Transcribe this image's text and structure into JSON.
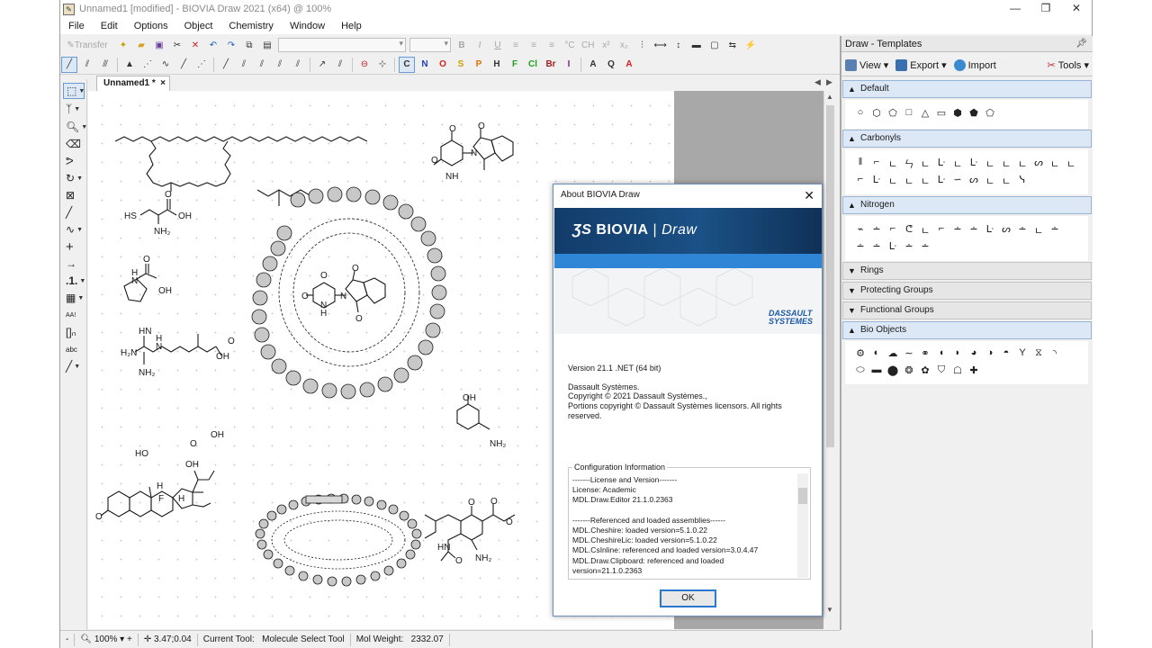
{
  "window": {
    "title": "Unnamed1 [modified] - BIOVIA Draw 2021 (x64)  @ 100%",
    "buttons": [
      "—",
      "❐",
      "✕"
    ]
  },
  "menu": [
    "File",
    "Edit",
    "Options",
    "Object",
    "Chemistry",
    "Window",
    "Help"
  ],
  "toolbar": {
    "transfer_label": "Transfer",
    "atom_buttons": [
      "C",
      "N",
      "O",
      "S",
      "P",
      "H",
      "F",
      "Cl",
      "Br",
      "I"
    ],
    "text_buttons": [
      "A",
      "Q"
    ]
  },
  "document_tab": {
    "label": "Unnamed1 *",
    "close": "×"
  },
  "canvas_labels": {
    "cys_hs": "HS",
    "cys_oh": "OH",
    "cys_nh2": "NH₂",
    "cys_o": "O",
    "pro_h": "H",
    "pro_n": "N",
    "pro_o": "O",
    "pro_oh": "OH",
    "arg_h2n": "H₂N",
    "arg_hn": "HN",
    "arg_nh2": "NH₂",
    "arg_n": "N",
    "arg_h": "H",
    "arg_o": "O",
    "arg_oh": "OH",
    "thal_o1": "O",
    "thal_o2": "O",
    "thal_o3": "O",
    "thal_n": "N",
    "thal_nh": "NH",
    "mic_o1": "O",
    "mic_o2": "O",
    "mic_o3": "O",
    "mic_n": "N",
    "mic_h": "H",
    "mic_n2": "N",
    "mic_o4": "O",
    "phen_oh": "OH",
    "phen_nh2": "NH₂",
    "ster_o": "O",
    "ster_ho": "HO",
    "ster_h1": "H",
    "ster_h2": "H",
    "ster_f": "F",
    "ster_o2": "O",
    "ster_oh": "OH",
    "ster_oh2": "OH",
    "osel_o1": "O",
    "osel_o2": "O",
    "osel_o3": "O",
    "osel_hn": "HN",
    "osel_nh2": "NH₂",
    "osel_o4": "O"
  },
  "status": {
    "zoom": "100%",
    "coords": "3.47;0.04",
    "current_tool_label": "Current Tool:",
    "current_tool": "Molecule Select Tool",
    "mol_weight_label": "Mol Weight:",
    "mol_weight": "2332.07"
  },
  "templates": {
    "title": "Draw - Templates",
    "view": "View",
    "export": "Export",
    "import": "Import",
    "tools": "Tools",
    "groups": [
      {
        "label": "Default",
        "open": true
      },
      {
        "label": "Carbonyls",
        "open": true
      },
      {
        "label": "Nitrogen",
        "open": true
      },
      {
        "label": "Rings",
        "open": false
      },
      {
        "label": "Protecting Groups",
        "open": false
      },
      {
        "label": "Functional Groups",
        "open": false
      },
      {
        "label": "Bio Objects",
        "open": true
      }
    ],
    "default_shapes": [
      "○",
      "⬡",
      "⬠",
      "□",
      "△",
      "▭",
      "⬢",
      "⬟",
      "⬠"
    ],
    "carbonyl_row1": [
      "ǁ",
      "⌐",
      "ㄴ",
      "ㄣ",
      "ㄴ",
      "ᒷ",
      "ㄴ",
      "ᒷ",
      "ㄴ",
      "ㄴ",
      "ㄴ",
      "ᔕ",
      "ㄴ",
      "ㄴ"
    ],
    "carbonyl_row2": [
      "⌐",
      "ᒷ",
      "ㄴ",
      "ㄴ",
      "ㄴ",
      "ᒷ",
      "∽",
      "ᔕ",
      "ㄴ",
      "ㄴ",
      "ᓭ"
    ],
    "nitrogen_row1": [
      "⌁",
      "∸",
      "⌐",
      "ᕦ",
      "ㄴ",
      "⌐",
      "∸",
      "∸",
      "ᒷ",
      "ᔕ",
      "∸",
      "ㄴ",
      "∸"
    ],
    "nitrogen_row2": [
      "∸",
      "∸",
      "ᒷ",
      "∸",
      "∸"
    ],
    "bio_row1": [
      "⚙",
      "◐",
      "☁",
      "∼",
      "⚭",
      "◖",
      "◗",
      "◕",
      "◑",
      "◓",
      "Y",
      "⧖",
      "◝"
    ],
    "bio_row2": [
      "⬭",
      "▬",
      "⬤",
      "❂",
      "✿",
      "⛉",
      "☖",
      "✚"
    ]
  },
  "about": {
    "title": "About BIOVIA Draw",
    "brand": "BIOVIA",
    "product": "Draw",
    "ds_line1": "DASSAULT",
    "ds_line2": "SYSTEMES",
    "version": "Version 21.1 .NET (64 bit)",
    "company": "Dassault Systèmes.",
    "copyright": "Copyright © 2021 Dassault Systèmes.,",
    "portions": "Portions copyright © Dassault Systèmes licensors. All rights reserved.",
    "config_label": "Configuration Information",
    "config_text": "-------License and Version-------\nLicense: Academic\nMDL.Draw.Editor 21.1.0.2363\n\n-------Referenced and loaded assemblies------\nMDL.Cheshire: loaded version=5.1.0.22\nMDL.CheshireLic: loaded version=5.1.0.22\nMDL.CsInline: referenced and loaded version=3.0.4.47\nMDL.Draw.Clipboard: referenced and loaded\nversion=21.1.0.2363",
    "ok": "OK"
  }
}
